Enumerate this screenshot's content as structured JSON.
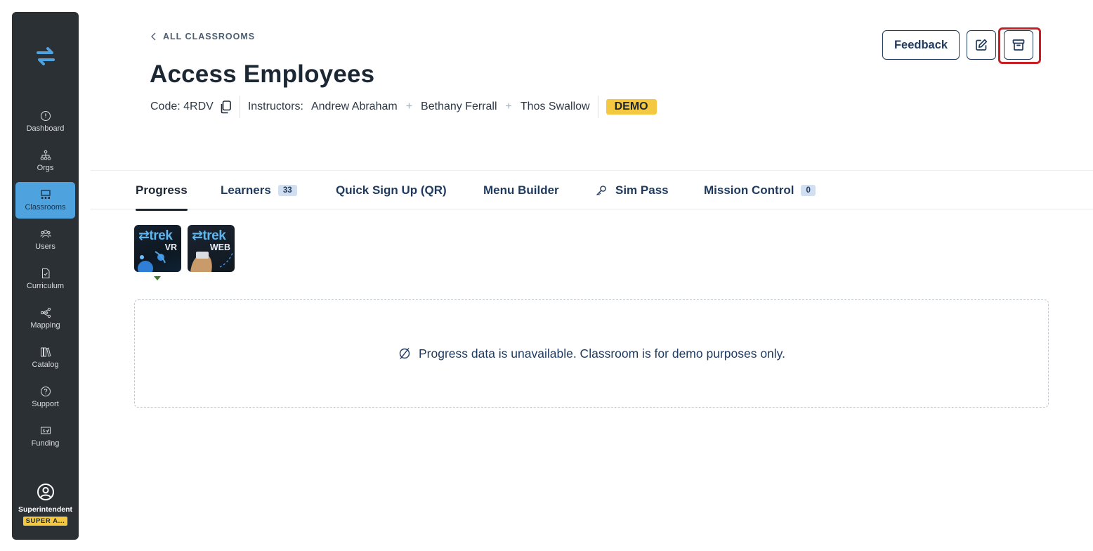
{
  "sidebar": {
    "items": [
      {
        "label": "Dashboard",
        "icon": "dashboard-icon"
      },
      {
        "label": "Orgs",
        "icon": "org-chart-icon"
      },
      {
        "label": "Classrooms",
        "icon": "classroom-icon",
        "active": true
      },
      {
        "label": "Users",
        "icon": "users-icon"
      },
      {
        "label": "Curriculum",
        "icon": "curriculum-icon"
      },
      {
        "label": "Mapping",
        "icon": "mapping-icon"
      },
      {
        "label": "Catalog",
        "icon": "catalog-icon"
      },
      {
        "label": "Support",
        "icon": "support-icon"
      },
      {
        "label": "Funding",
        "icon": "funding-icon"
      }
    ],
    "user": {
      "name": "Superintendent",
      "role_badge": "SUPER A..."
    }
  },
  "header": {
    "back_label": "ALL CLASSROOMS",
    "title": "Access Employees",
    "code_label": "Code: 4RDV",
    "instructors_label": "Instructors:",
    "instructors": [
      "Andrew Abraham",
      "Bethany Ferrall",
      "Thos Swallow"
    ],
    "demo_badge": "DEMO",
    "feedback_label": "Feedback"
  },
  "tabs": [
    {
      "label": "Progress",
      "active": true
    },
    {
      "label": "Learners",
      "count": "33"
    },
    {
      "label": "Quick Sign Up (QR)"
    },
    {
      "label": "Menu Builder"
    },
    {
      "label": "Sim Pass",
      "icon": "key-icon"
    },
    {
      "label": "Mission Control",
      "count": "0"
    }
  ],
  "products": [
    {
      "logo": "⇄trek",
      "sub": "VR",
      "selected": true
    },
    {
      "logo": "⇄trek",
      "sub": "WEB"
    }
  ],
  "empty_state": {
    "message": "Progress data is unavailable. Classroom is for demo purposes only."
  },
  "colors": {
    "sidebar_bg": "#2b3035",
    "active_nav": "#4ea3df",
    "badge_yellow": "#f5c842",
    "navy": "#1e3a5f",
    "highlight": "#c81f25"
  }
}
